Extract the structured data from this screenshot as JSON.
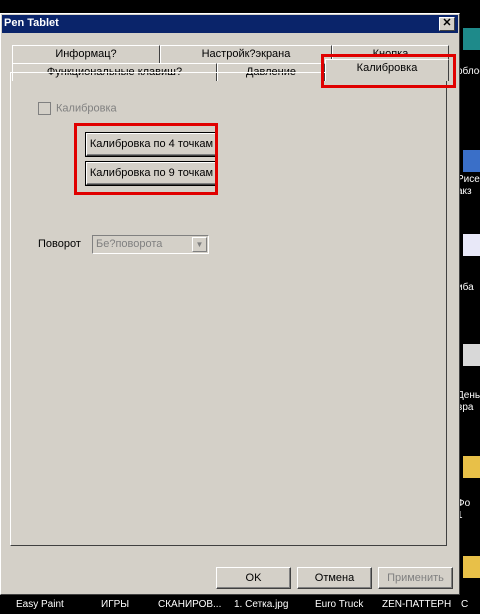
{
  "window": {
    "title": "Pen Tablet",
    "close_glyph": "✕"
  },
  "tabs_row1": [
    "Информац?",
    "Настройк?экрана",
    "Кнопка"
  ],
  "tabs_row2": [
    "Функциональные клавиш?",
    "Давление",
    "Калибровка"
  ],
  "active_tab": "Калибровка",
  "calibration": {
    "checkbox_label": "Калибровка",
    "checkbox_checked": false,
    "btn4": "Калибровка по 4 точкам",
    "btn9": "Калибровка по 9 точкам"
  },
  "rotation": {
    "label": "Поворот",
    "value": "Бе?поворота"
  },
  "buttons": {
    "ok": "OK",
    "cancel": "Отмена",
    "apply": "Применить"
  },
  "desktop": {
    "labels": [
      "облос",
      "Рисе",
      "акз",
      "иба",
      "День",
      "вра",
      "Фо",
      "1"
    ],
    "taskbar": [
      "Easy Paint",
      "ИГРЫ",
      "СКАНИРОВ...",
      "1. Сетка.jpg",
      "Euro Truck",
      "ZEN-ПАТТЕРН",
      "С"
    ]
  },
  "highlight_color": "#e00000"
}
